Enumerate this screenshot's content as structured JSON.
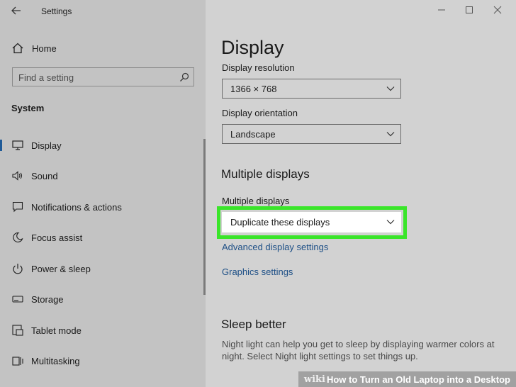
{
  "window": {
    "title": "Settings",
    "controls": [
      "minimize",
      "maximize",
      "close"
    ]
  },
  "sidebar": {
    "home_label": "Home",
    "search_placeholder": "Find a setting",
    "section": "System",
    "items": [
      {
        "label": "Display",
        "icon": "monitor-icon",
        "active": true
      },
      {
        "label": "Sound",
        "icon": "speaker-icon",
        "active": false
      },
      {
        "label": "Notifications & actions",
        "icon": "notification-icon",
        "active": false
      },
      {
        "label": "Focus assist",
        "icon": "moon-icon",
        "active": false
      },
      {
        "label": "Power & sleep",
        "icon": "power-icon",
        "active": false
      },
      {
        "label": "Storage",
        "icon": "storage-icon",
        "active": false
      },
      {
        "label": "Tablet mode",
        "icon": "tablet-icon",
        "active": false
      },
      {
        "label": "Multitasking",
        "icon": "multitasking-icon",
        "active": false
      }
    ]
  },
  "main": {
    "page_title": "Display",
    "resolution": {
      "label": "Display resolution",
      "value": "1366 × 768"
    },
    "orientation": {
      "label": "Display orientation",
      "value": "Landscape"
    },
    "multiple_displays_title": "Multiple displays",
    "multiple_displays": {
      "label": "Multiple displays",
      "value": "Duplicate these displays"
    },
    "links": {
      "advanced": "Advanced display settings",
      "graphics": "Graphics settings"
    },
    "sleep_title": "Sleep better",
    "sleep_text": "Night light can help you get to sleep by displaying warmer colors at night. Select Night light settings to set things up."
  },
  "watermark": {
    "brand": "wiki",
    "text": "How to Turn an Old Laptop into a Desktop"
  },
  "colors": {
    "highlight": "#3ae52a",
    "link": "#1d4f86",
    "accent": "#1f5a97"
  }
}
